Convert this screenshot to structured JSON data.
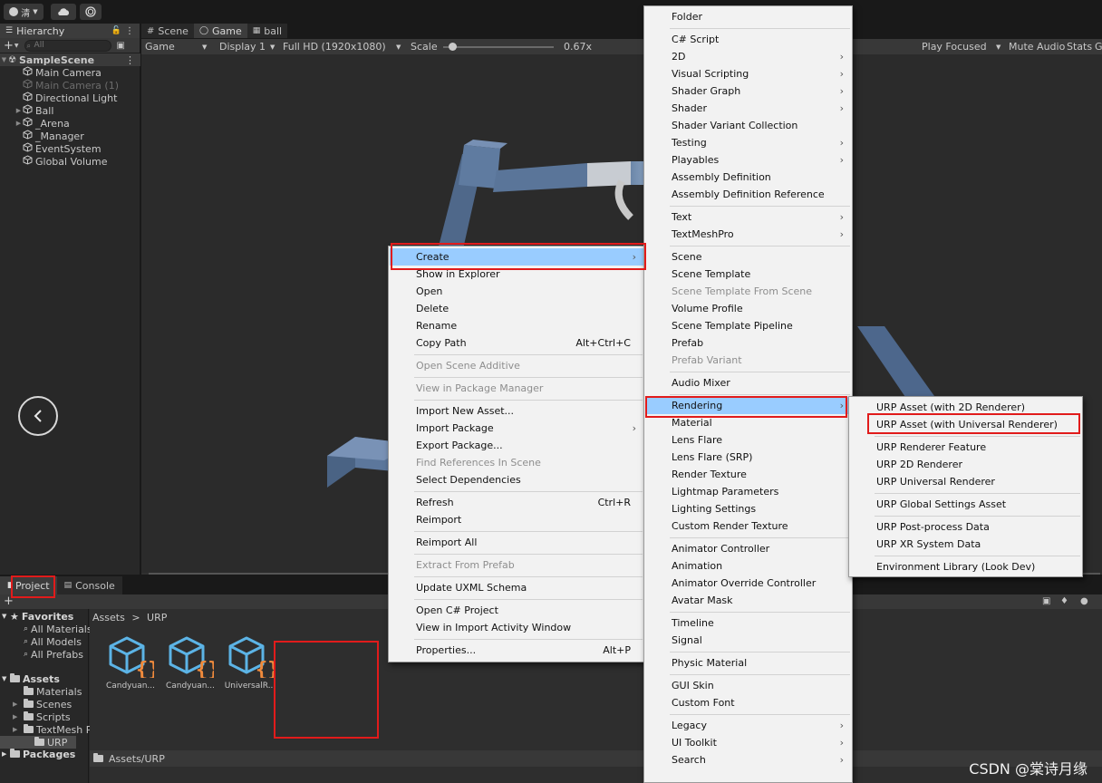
{
  "toolbar": {
    "account_label": "清",
    "account_icon": "account-icon",
    "cloud_icon": "cloud-icon",
    "collab_icon": "collab-icon"
  },
  "hierarchy": {
    "tab_label": "Hierarchy",
    "search_placeholder": "All",
    "scene_name": "SampleScene",
    "items": [
      {
        "label": "Main Camera",
        "disabled": false
      },
      {
        "label": "Main Camera (1)",
        "disabled": true
      },
      {
        "label": "Directional Light",
        "disabled": false
      },
      {
        "label": "Ball",
        "disabled": false
      },
      {
        "label": "_Arena",
        "disabled": false
      },
      {
        "label": "_Manager",
        "disabled": false
      },
      {
        "label": "EventSystem",
        "disabled": false
      },
      {
        "label": "Global Volume",
        "disabled": false
      }
    ]
  },
  "game": {
    "tabs": [
      "Scene",
      "Game",
      "ball"
    ],
    "view_mode": "Game",
    "display": "Display 1",
    "resolution": "Full HD (1920x1080)",
    "scale_label": "Scale",
    "scale_value": "0.67x",
    "scale_level": 0.09,
    "play_focused": "Play Focused",
    "mute_audio": "Mute Audio",
    "stats": "Stats",
    "extra": "G"
  },
  "project": {
    "tabs": [
      "Project",
      "Console"
    ],
    "favorites": {
      "title": "Favorites",
      "items": [
        "All Materials",
        "All Models",
        "All Prefabs"
      ]
    },
    "assets": {
      "title": "Assets",
      "items": [
        "Materials",
        "Scenes",
        "Scripts",
        "TextMesh P",
        "URP"
      ]
    },
    "packages": "Packages",
    "breadcrumb": [
      "Assets",
      "URP"
    ],
    "breadcrumb_sep": ">",
    "asset_files": [
      "Candyuan...",
      "Candyuan...",
      "UniversalR..."
    ],
    "status_path": "Assets/URP"
  },
  "context_menu": {
    "items": [
      {
        "label": "Create",
        "submenu": true,
        "selected": true
      },
      {
        "label": "Show in Explorer"
      },
      {
        "label": "Open"
      },
      {
        "label": "Delete"
      },
      {
        "label": "Rename"
      },
      {
        "label": "Copy Path",
        "shortcut": "Alt+Ctrl+C"
      },
      {
        "label": "Open Scene Additive",
        "disabled": true
      },
      {
        "label": "View in Package Manager",
        "disabled": true
      },
      {
        "label": "Import New Asset..."
      },
      {
        "label": "Import Package",
        "submenu": true
      },
      {
        "label": "Export Package..."
      },
      {
        "label": "Find References In Scene",
        "disabled": true
      },
      {
        "label": "Select Dependencies"
      },
      {
        "label": "Refresh",
        "shortcut": "Ctrl+R"
      },
      {
        "label": "Reimport"
      },
      {
        "label": "Reimport All"
      },
      {
        "label": "Extract From Prefab",
        "disabled": true
      },
      {
        "label": "Update UXML Schema"
      },
      {
        "label": "Open C# Project"
      },
      {
        "label": "View in Import Activity Window"
      },
      {
        "label": "Properties...",
        "shortcut": "Alt+P"
      }
    ]
  },
  "create_menu": {
    "items": [
      {
        "label": "Folder"
      },
      {
        "label": "C# Script"
      },
      {
        "label": "2D",
        "submenu": true
      },
      {
        "label": "Visual Scripting",
        "submenu": true
      },
      {
        "label": "Shader Graph",
        "submenu": true
      },
      {
        "label": "Shader",
        "submenu": true
      },
      {
        "label": "Shader Variant Collection"
      },
      {
        "label": "Testing",
        "submenu": true
      },
      {
        "label": "Playables",
        "submenu": true
      },
      {
        "label": "Assembly Definition"
      },
      {
        "label": "Assembly Definition Reference"
      },
      {
        "label": "Text",
        "submenu": true
      },
      {
        "label": "TextMeshPro",
        "submenu": true
      },
      {
        "label": "Scene"
      },
      {
        "label": "Scene Template"
      },
      {
        "label": "Scene Template From Scene",
        "disabled": true
      },
      {
        "label": "Volume Profile"
      },
      {
        "label": "Scene Template Pipeline"
      },
      {
        "label": "Prefab"
      },
      {
        "label": "Prefab Variant",
        "disabled": true
      },
      {
        "label": "Audio Mixer"
      },
      {
        "label": "Rendering",
        "submenu": true,
        "selected": true
      },
      {
        "label": "Material"
      },
      {
        "label": "Lens Flare"
      },
      {
        "label": "Lens Flare (SRP)"
      },
      {
        "label": "Render Texture"
      },
      {
        "label": "Lightmap Parameters"
      },
      {
        "label": "Lighting Settings"
      },
      {
        "label": "Custom Render Texture"
      },
      {
        "label": "Animator Controller"
      },
      {
        "label": "Animation"
      },
      {
        "label": "Animator Override Controller"
      },
      {
        "label": "Avatar Mask"
      },
      {
        "label": "Timeline"
      },
      {
        "label": "Signal"
      },
      {
        "label": "Physic Material"
      },
      {
        "label": "GUI Skin"
      },
      {
        "label": "Custom Font"
      },
      {
        "label": "Legacy",
        "submenu": true
      },
      {
        "label": "UI Toolkit",
        "submenu": true
      },
      {
        "label": "Search",
        "submenu": true
      }
    ]
  },
  "rendering_menu": {
    "items": [
      {
        "label": "URP Asset (with 2D Renderer)"
      },
      {
        "label": "URP Asset (with Universal Renderer)"
      },
      {
        "label": "URP Renderer Feature"
      },
      {
        "label": "URP 2D Renderer"
      },
      {
        "label": "URP Universal Renderer"
      },
      {
        "label": "URP Global Settings Asset"
      },
      {
        "label": "URP Post-process Data"
      },
      {
        "label": "URP XR System Data"
      },
      {
        "label": "Environment Library (Look Dev)"
      }
    ]
  },
  "watermark": "CSDN @棠诗月缘",
  "colors": {
    "menu_bg": "#f2f2f2",
    "menu_selected": "#99ccff",
    "highlight_box": "#e11b1b",
    "editor_bg": "#282828"
  }
}
